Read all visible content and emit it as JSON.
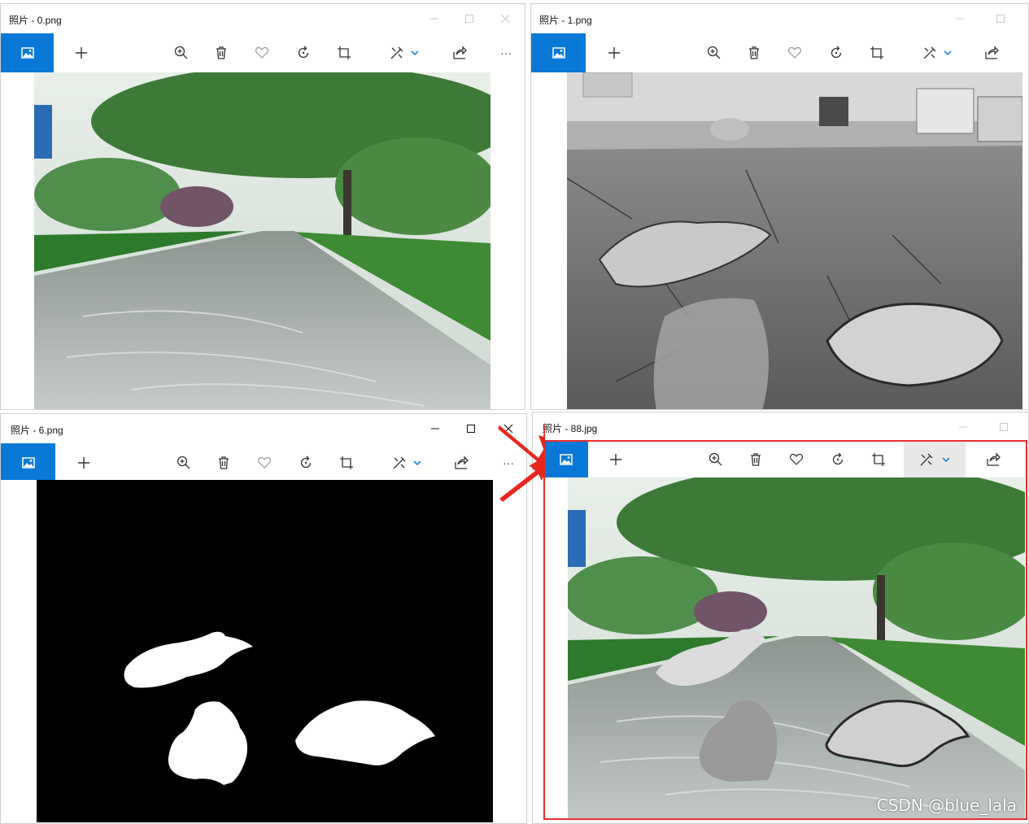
{
  "windows": [
    {
      "id": "w0",
      "title": "照片 - 0.png"
    },
    {
      "id": "w1",
      "title": "照片 - 1.png"
    },
    {
      "id": "w2",
      "title": "照片 - 6.png"
    },
    {
      "id": "w3",
      "title": "照片 - 88.jpg"
    }
  ],
  "toolbar": {
    "icons": [
      "image-icon",
      "add-icon",
      "zoom-in-icon",
      "delete-icon",
      "favorite-icon",
      "rotate-icon",
      "crop-icon",
      "edit-icon",
      "chevron-down-icon",
      "share-icon",
      "more-icon"
    ],
    "more_label": "···"
  },
  "watermark": "CSDN @blue_lala",
  "colors": {
    "accent": "#0a78d7",
    "highlight": "#ea2c2c",
    "arrow": "#e8261f"
  }
}
